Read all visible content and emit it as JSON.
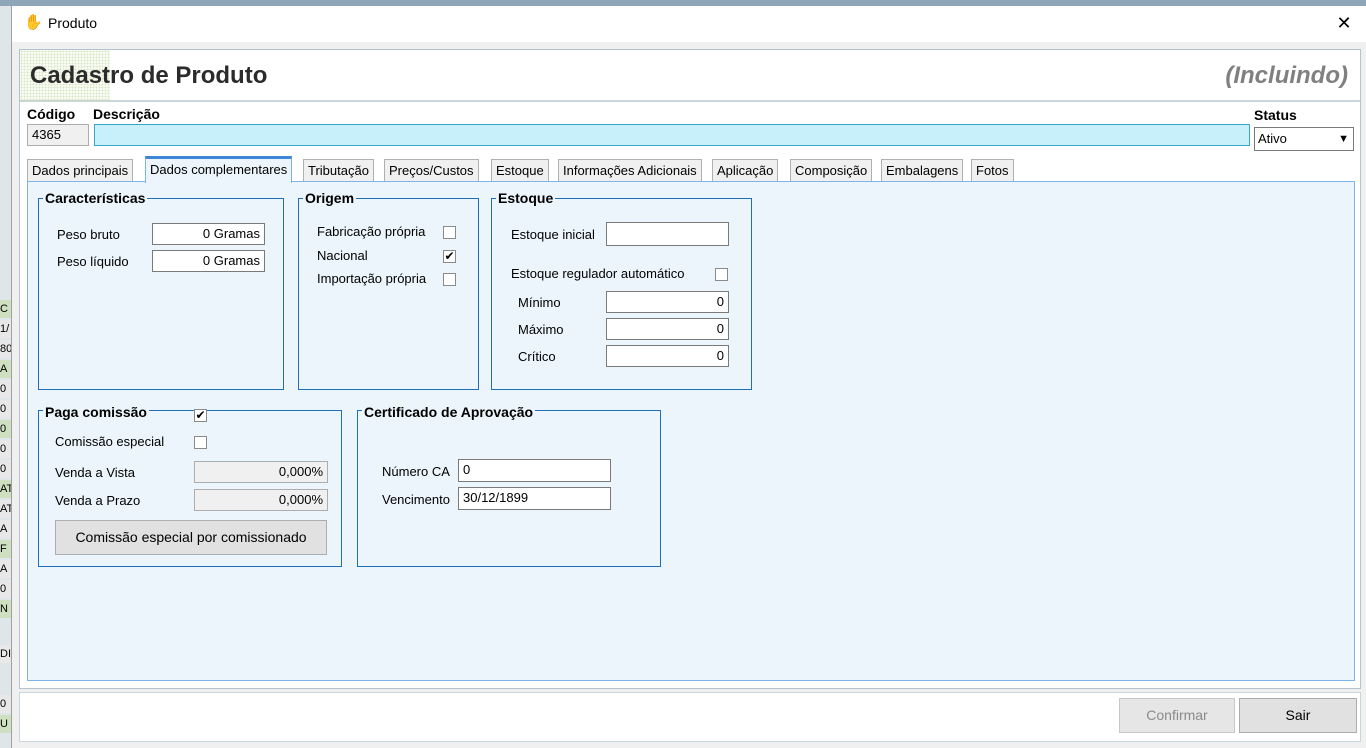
{
  "background": {
    "left_cells": [
      "C",
      "1/",
      "80",
      "A",
      "0",
      "0",
      "0",
      "0",
      "0",
      "AT",
      "AT",
      "A",
      "F",
      "A",
      "0",
      "N",
      "DI",
      "0",
      "U"
    ]
  },
  "window": {
    "title": "Produto",
    "close_symbol": "✕",
    "icon": "hand-icon"
  },
  "header": {
    "title": "Cadastro de Produto",
    "mode": "(Incluindo)"
  },
  "top_fields": {
    "codigo_label": "Código",
    "codigo_value": "4365",
    "descricao_label": "Descrição",
    "descricao_value": "",
    "status_label": "Status",
    "status_value": "Ativo"
  },
  "tabs": [
    {
      "label": "Dados principais",
      "active": false
    },
    {
      "label": "Dados complementares",
      "active": true
    },
    {
      "label": "Tributação",
      "active": false
    },
    {
      "label": "Preços/Custos",
      "active": false
    },
    {
      "label": "Estoque",
      "active": false
    },
    {
      "label": "Informações Adicionais",
      "active": false
    },
    {
      "label": "Aplicação",
      "active": false
    },
    {
      "label": "Composição",
      "active": false
    },
    {
      "label": "Embalagens",
      "active": false
    },
    {
      "label": "Fotos",
      "active": false
    }
  ],
  "caracteristicas": {
    "title": "Características",
    "peso_bruto_label": "Peso bruto",
    "peso_bruto_value": "0 Gramas",
    "peso_liquido_label": "Peso líquido",
    "peso_liquido_value": "0 Gramas"
  },
  "origem": {
    "title": "Origem",
    "fabricacao_label": "Fabricação própria",
    "fabricacao_checked": false,
    "nacional_label": "Nacional",
    "nacional_checked": true,
    "importacao_label": "Importação própria",
    "importacao_checked": false
  },
  "estoque": {
    "title": "Estoque",
    "inicial_label": "Estoque inicial",
    "inicial_value": "",
    "regulador_label": "Estoque regulador automático",
    "regulador_checked": false,
    "minimo_label": "Mínimo",
    "minimo_value": "0",
    "maximo_label": "Máximo",
    "maximo_value": "0",
    "critico_label": "Crítico",
    "critico_value": "0"
  },
  "comissao": {
    "title": "Paga comissão",
    "paga_checked": true,
    "especial_label": "Comissão especial",
    "especial_checked": false,
    "vista_label": "Venda a Vista",
    "vista_value": "0,000%",
    "prazo_label": "Venda a Prazo",
    "prazo_value": "0,000%",
    "button_label": "Comissão especial por comissionado"
  },
  "certificado": {
    "title": "Certificado de Aprovação",
    "numero_label": "Número CA",
    "numero_value": "0",
    "vencimento_label": "Vencimento",
    "vencimento_value": "30/12/1899"
  },
  "footer": {
    "confirmar_label": "Confirmar",
    "sair_label": "Sair"
  },
  "colors": {
    "accent": "#3c87d8",
    "group_border": "#1e6fb8",
    "description_fill": "#c7f0fb"
  }
}
